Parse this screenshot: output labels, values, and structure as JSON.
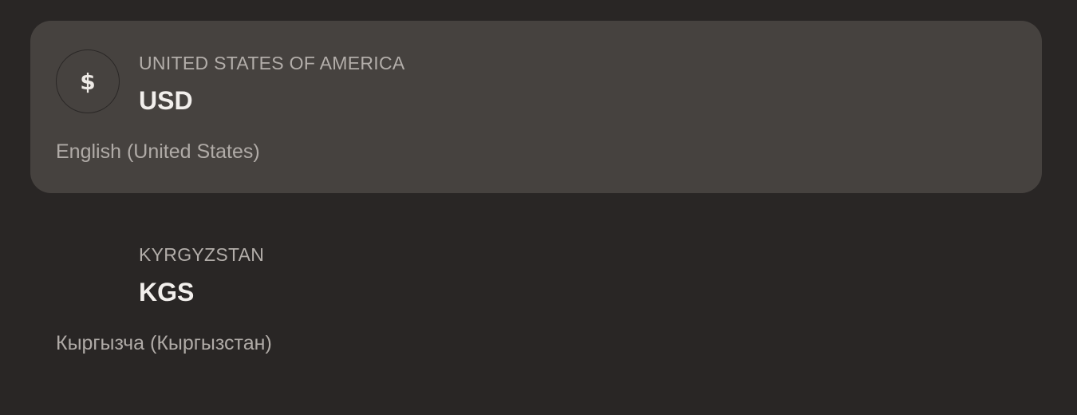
{
  "currencies": [
    {
      "country": "UNITED STATES OF AMERICA",
      "code": "USD",
      "symbol": "$",
      "locale": "English (United States)",
      "selected": true
    },
    {
      "country": "KYRGYZSTAN",
      "code": "KGS",
      "symbol": "",
      "locale": "Кыргызча (Кыргызстан)",
      "selected": false
    }
  ],
  "colors": {
    "background": "#292625",
    "selected_background": "#46423f",
    "code_text": "#f2efec",
    "secondary_text": "#b3aeaa"
  }
}
